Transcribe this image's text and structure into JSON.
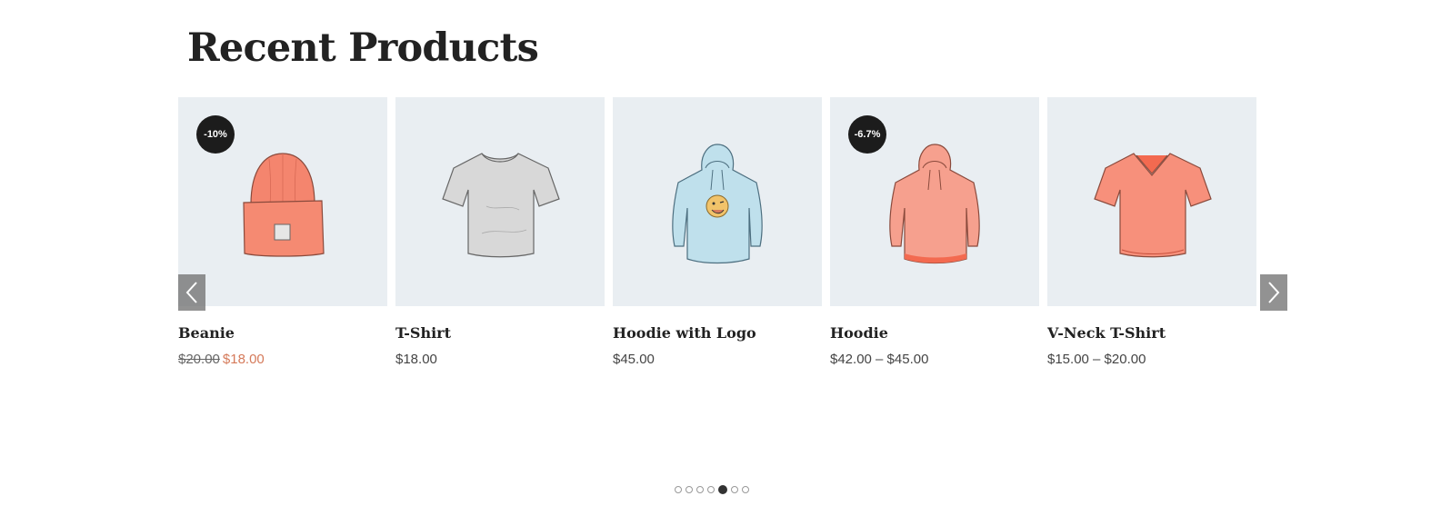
{
  "section": {
    "title": "Recent Products"
  },
  "products": [
    {
      "name": "Beanie",
      "badge": "-10%",
      "old_price": "$20.00",
      "price": "$18.00",
      "icon": "beanie-icon",
      "color": "#f4856e"
    },
    {
      "name": "T-Shirt",
      "badge": "",
      "old_price": "",
      "price": "$18.00",
      "icon": "tshirt-icon",
      "color": "#d8d8d8"
    },
    {
      "name": "Hoodie with Logo",
      "badge": "",
      "old_price": "",
      "price": "$45.00",
      "icon": "hoodie-logo-icon",
      "color": "#bfe0ec"
    },
    {
      "name": "Hoodie",
      "badge": "-6.7%",
      "old_price": "",
      "price": "$42.00 – $45.00",
      "icon": "hoodie-icon",
      "color": "#f6a08e"
    },
    {
      "name": "V-Neck T-Shirt",
      "badge": "",
      "old_price": "",
      "price": "$15.00 – $20.00",
      "icon": "vneck-tshirt-icon",
      "color": "#f7907b"
    }
  ],
  "carousel": {
    "prev_icon": "chevron-left-icon",
    "next_icon": "chevron-right-icon",
    "page_count": 7,
    "active_page": 5
  },
  "colors": {
    "sale": "#d57a5a",
    "badge_bg": "#1c1c1c",
    "thumb_bg": "#e9eef2"
  }
}
